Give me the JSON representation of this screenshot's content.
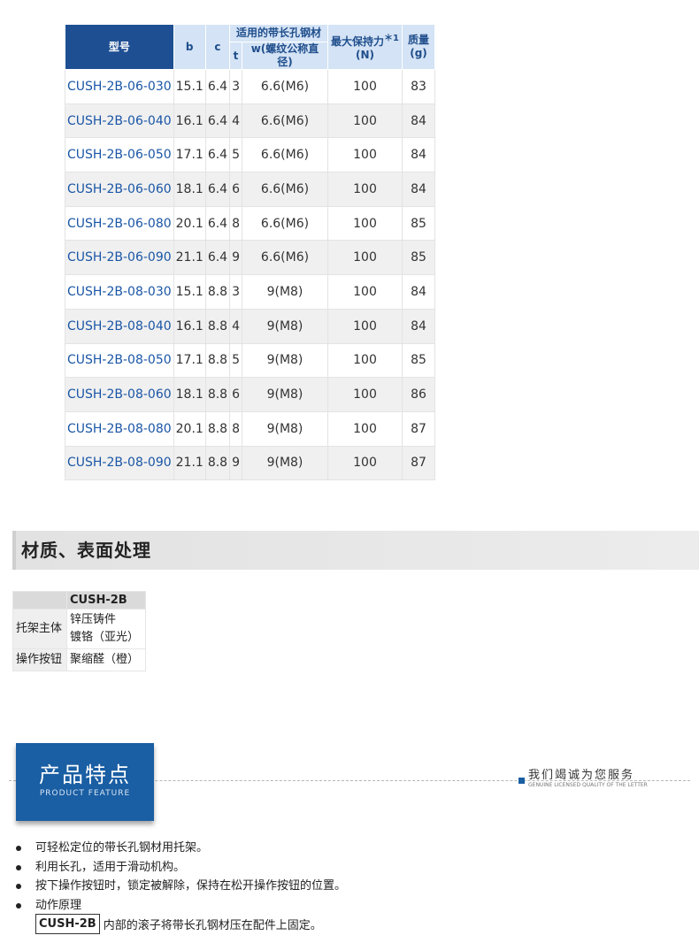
{
  "spec_table": {
    "headers": {
      "model": "型号",
      "b": "b",
      "c": "c",
      "group_label": "适用的带长孔钢材",
      "t": "t",
      "w": "w(螺纹公称直径)",
      "force_label": "最大保持力",
      "force_note": "＊1",
      "force_unit": "(N)",
      "mass_label": "质量",
      "mass_unit": "(g)"
    },
    "rows": [
      {
        "model": "CUSH-2B-06-030",
        "b": "15.1",
        "c": "6.4",
        "t": "3",
        "w": "6.6(M6)",
        "force": "100",
        "mass": "83"
      },
      {
        "model": "CUSH-2B-06-040",
        "b": "16.1",
        "c": "6.4",
        "t": "4",
        "w": "6.6(M6)",
        "force": "100",
        "mass": "84"
      },
      {
        "model": "CUSH-2B-06-050",
        "b": "17.1",
        "c": "6.4",
        "t": "5",
        "w": "6.6(M6)",
        "force": "100",
        "mass": "84"
      },
      {
        "model": "CUSH-2B-06-060",
        "b": "18.1",
        "c": "6.4",
        "t": "6",
        "w": "6.6(M6)",
        "force": "100",
        "mass": "84"
      },
      {
        "model": "CUSH-2B-06-080",
        "b": "20.1",
        "c": "6.4",
        "t": "8",
        "w": "6.6(M6)",
        "force": "100",
        "mass": "85"
      },
      {
        "model": "CUSH-2B-06-090",
        "b": "21.1",
        "c": "6.4",
        "t": "9",
        "w": "6.6(M6)",
        "force": "100",
        "mass": "85"
      },
      {
        "model": "CUSH-2B-08-030",
        "b": "15.1",
        "c": "8.8",
        "t": "3",
        "w": "9(M8)",
        "force": "100",
        "mass": "84"
      },
      {
        "model": "CUSH-2B-08-040",
        "b": "16.1",
        "c": "8.8",
        "t": "4",
        "w": "9(M8)",
        "force": "100",
        "mass": "84"
      },
      {
        "model": "CUSH-2B-08-050",
        "b": "17.1",
        "c": "8.8",
        "t": "5",
        "w": "9(M8)",
        "force": "100",
        "mass": "85"
      },
      {
        "model": "CUSH-2B-08-060",
        "b": "18.1",
        "c": "8.8",
        "t": "6",
        "w": "9(M8)",
        "force": "100",
        "mass": "86"
      },
      {
        "model": "CUSH-2B-08-080",
        "b": "20.1",
        "c": "8.8",
        "t": "8",
        "w": "9(M8)",
        "force": "100",
        "mass": "87"
      },
      {
        "model": "CUSH-2B-08-090",
        "b": "21.1",
        "c": "8.8",
        "t": "9",
        "w": "9(M8)",
        "force": "100",
        "mass": "87"
      }
    ]
  },
  "material": {
    "heading": "材质、表面处理",
    "column_header": "CUSH-2B",
    "rows": [
      {
        "label": "托架主体",
        "line1": "锌压铸件",
        "line2": "镀铬（亚光）"
      },
      {
        "label": "操作按钮",
        "line1": "聚缩醛（橙）",
        "line2": ""
      }
    ]
  },
  "feature_banner": {
    "title": "产品特点",
    "subtitle": "PRODUCT FEATURE",
    "service_main": "我们竭诚为您服务",
    "service_sub": "GENUINE LICENSED QUALITY OF THE LETTER"
  },
  "features": [
    "可轻松定位的带长孔钢材用托架。",
    "利用长孔，适用于滑动机构。",
    "按下操作按钮时，锁定被解除，保持在松开操作按钮的位置。",
    "动作原理"
  ],
  "principle": {
    "model": "CUSH-2B",
    "text": "内部的滚子将带长孔钢材压在配件上固定。"
  },
  "colors": {
    "header_dark": "#1e4f93",
    "header_light": "#d4e3f5",
    "model_link": "#1a56a6",
    "badge_blue": "#1a5ea3"
  }
}
